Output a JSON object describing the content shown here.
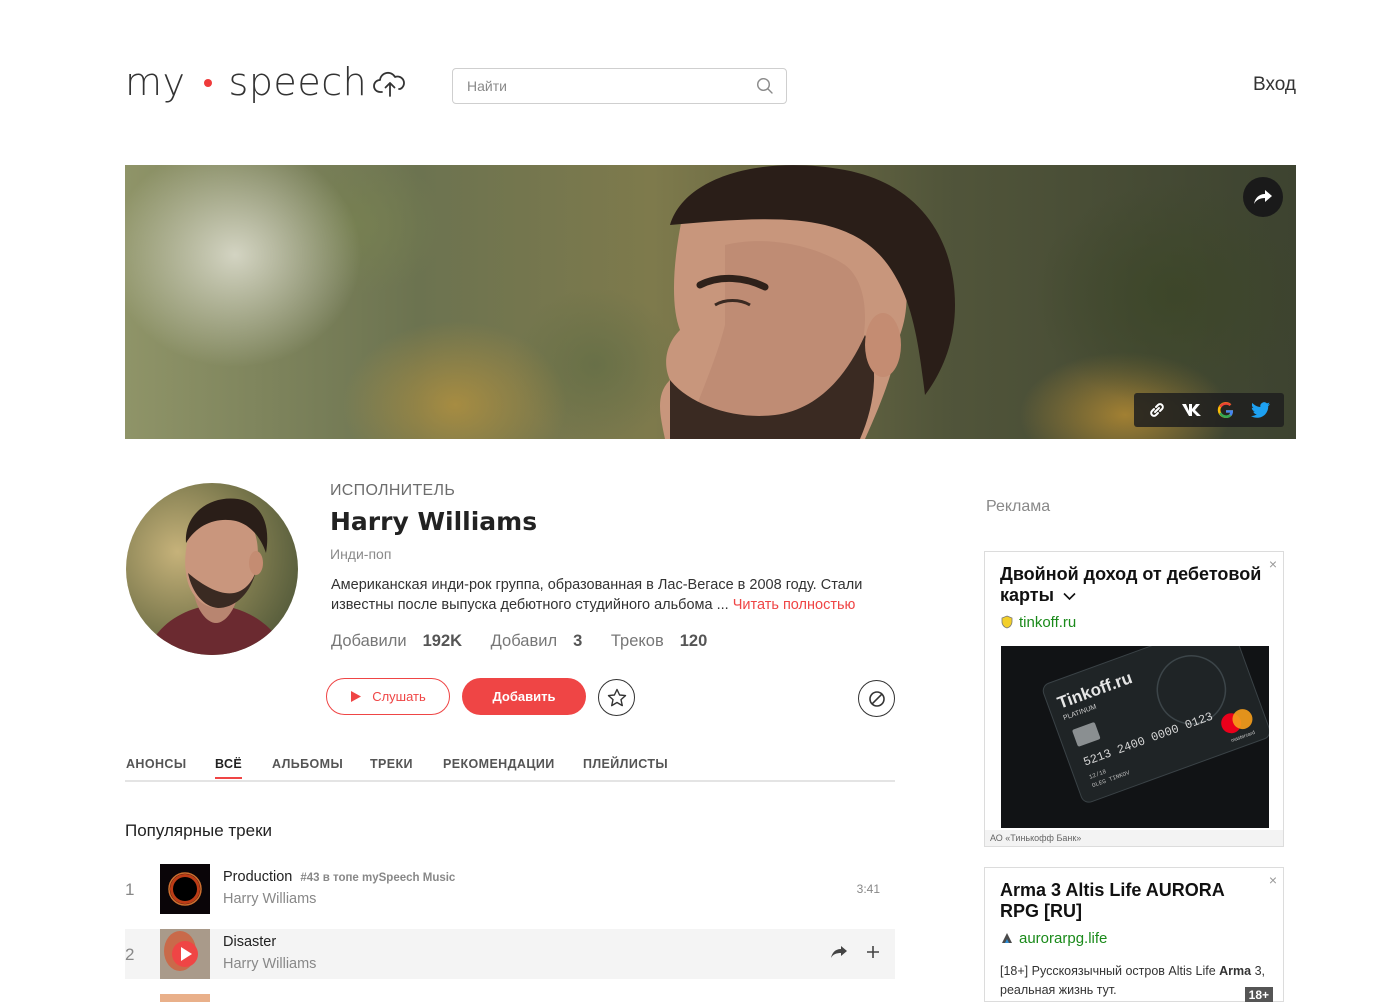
{
  "header": {
    "logo_left": "my",
    "logo_right": "speech",
    "search_placeholder": "Найти",
    "login_label": "Вход"
  },
  "artist": {
    "role": "ИСПОЛНИТЕЛЬ",
    "name": "Harry Williams",
    "genre": "Инди-поп",
    "description": "Американская инди-рок группа, образованная в Лас-Вегасе в 2008 году. Стали известны после выпуска дебютного студийного альбома ... ",
    "read_more": "Читать полностью",
    "stats": [
      {
        "label": "Добавили",
        "value": "192K"
      },
      {
        "label": "Добавил",
        "value": "3"
      },
      {
        "label": "Треков",
        "value": "120"
      }
    ]
  },
  "actions": {
    "listen_label": "Слушать",
    "add_label": "Добавить"
  },
  "tabs": [
    "АНОНСЫ",
    "ВСЁ",
    "АЛЬБОМЫ",
    "ТРЕКИ",
    "РЕКОМЕНДАЦИИ",
    "ПЛЕЙЛИСТЫ"
  ],
  "active_tab": "ВСЁ",
  "popular": {
    "title": "Популярные треки",
    "tracks": [
      {
        "num": "1",
        "title": "Production",
        "badge": "#43 в топе mySpeech Music",
        "artist": "Harry Williams",
        "duration": "3:41"
      },
      {
        "num": "2",
        "title": "Disaster",
        "badge": "",
        "artist": "Harry Williams",
        "duration": ""
      }
    ]
  },
  "ads": {
    "label": "Реклама",
    "items": [
      {
        "title": "Двойной доход от дебетовой карты",
        "link": "tinkoff.ru",
        "legal": "АО «Тинькофф Банк»",
        "card_text": "Tinkoff.ru",
        "card_sub": "PLATINUM",
        "card_number": "5213 2400 0000 0123",
        "card_name": "OLEG TINKOV",
        "card_exp": "12/18",
        "card_world": "world",
        "card_brand": "mastercard",
        "close": "×"
      },
      {
        "title": "Arma 3 Altis Life AURORA RPG [RU]",
        "link": "aurorarpg.life",
        "text_prefix": "[18+] Русскоязычный остров Altis Life ",
        "text_bold": "Arma",
        "text_suffix": " 3, реальная жизнь тут.",
        "age": "18+",
        "close": "×"
      }
    ]
  },
  "colors": {
    "accent": "#ef4545",
    "ad_link": "#1a8a1a"
  }
}
